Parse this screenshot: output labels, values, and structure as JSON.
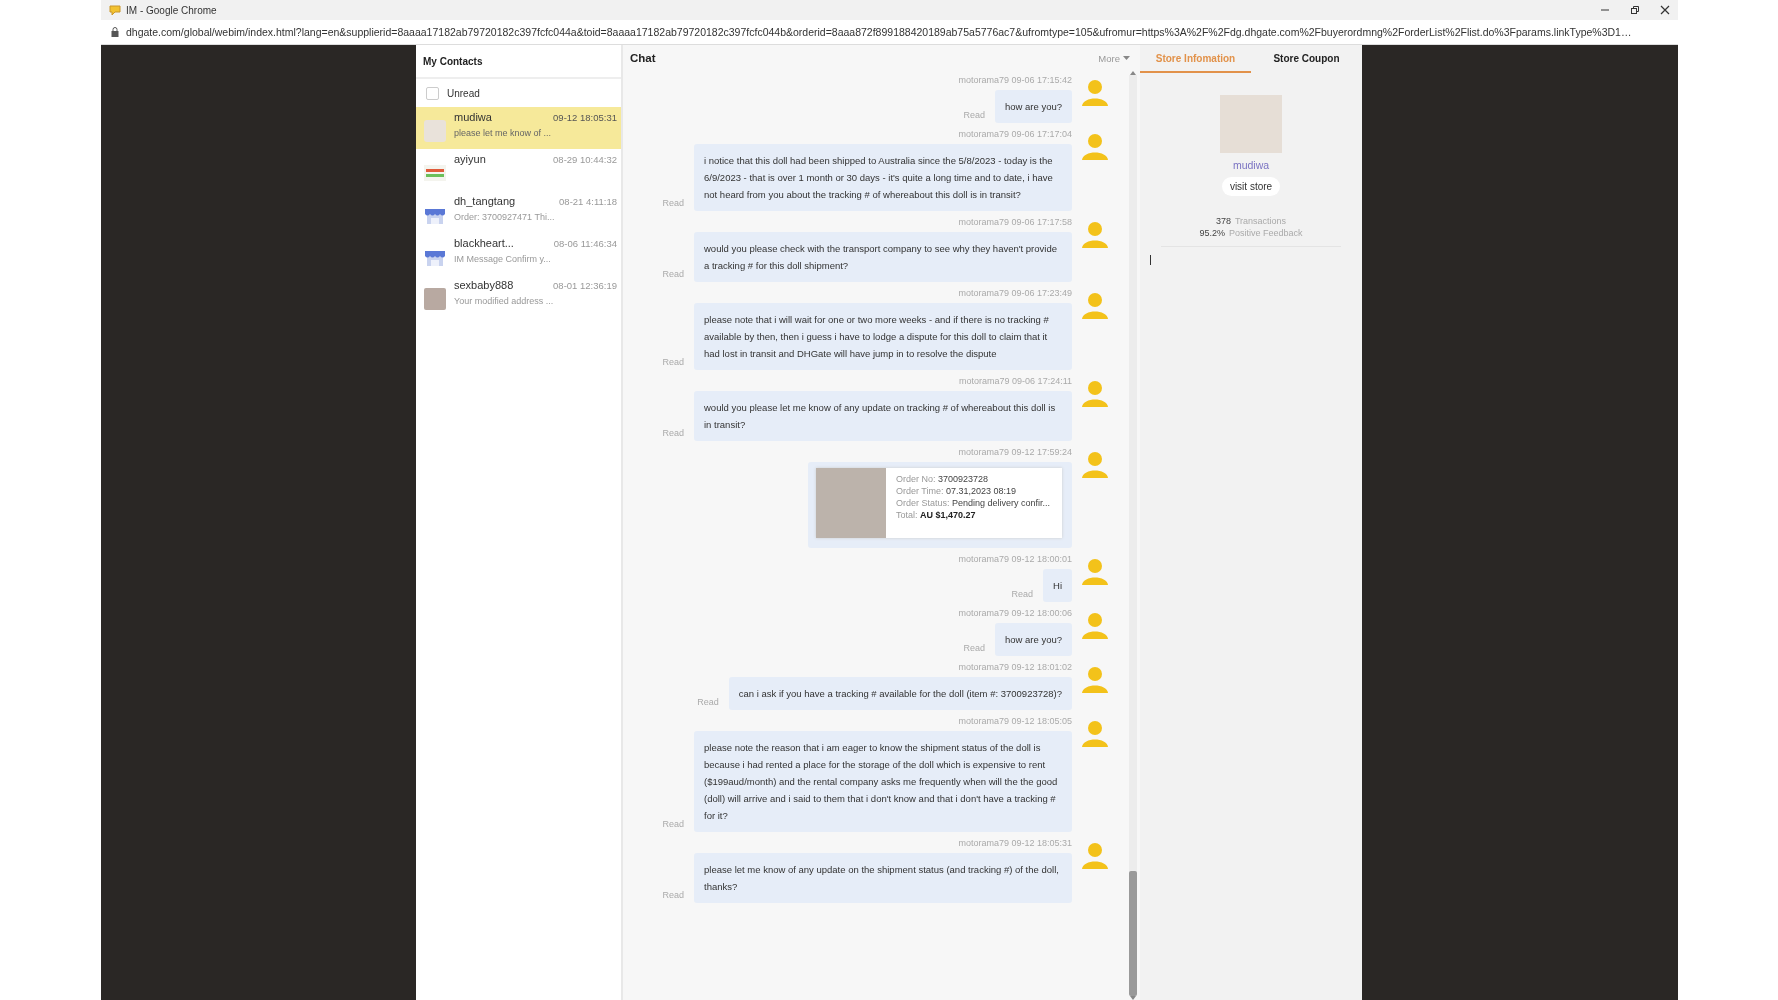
{
  "browser": {
    "title": "IM - Google Chrome",
    "url": "dhgate.com/global/webim/index.html?lang=en&supplierid=8aaaa17182ab79720182c397fcfc044a&toid=8aaaa17182ab79720182c397fcfc044b&orderid=8aaa872f899188420189ab75a5776ac7&ufromtype=105&ufromur=https%3A%2F%2Fdg.dhgate.com%2Fbuyerordmng%2ForderList%2Flist.do%3Fparams.linkType%3D1…"
  },
  "contacts": {
    "title": "My Contacts",
    "unread_filter": {
      "label": "Unread",
      "checked": false
    },
    "items": [
      {
        "name": "mudiwa",
        "time": "09-12 18:05:31",
        "preview": "please let me know of ...",
        "kind": "illustration",
        "selected": true
      },
      {
        "name": "ayiyun",
        "time": "08-29 10:44:32",
        "kind": "logo",
        "selected": false
      },
      {
        "name": "dh_tangtang",
        "time": "08-21 4:11:18",
        "preview": "Order: 3700927471 Thi...",
        "kind": "store",
        "selected": false
      },
      {
        "name": "blackheart...",
        "time": "08-06 11:46:34",
        "preview": "IM Message Confirm y...",
        "kind": "store",
        "selected": false
      },
      {
        "name": "sexbaby888",
        "time": "08-01 12:36:19",
        "preview": "Your modified address ...",
        "kind": "photo",
        "selected": false
      }
    ]
  },
  "chat": {
    "title": "Chat",
    "more": "More",
    "messages": [
      {
        "kind": "text",
        "meta": "motorama79 09-06 17:15:42",
        "status": "Read",
        "text": "how are you?"
      },
      {
        "kind": "text",
        "meta": "motorama79 09-06 17:17:04",
        "status": "Read",
        "text": "i notice that this doll had been shipped to Australia since the 5/8/2023 - today is the 6/9/2023 - that is over 1 month or 30 days - it's quite a long time and to date, i have not heard from you about the tracking # of whereabout this doll is in transit?"
      },
      {
        "kind": "text",
        "meta": "motorama79 09-06 17:17:58",
        "status": "Read",
        "text": "would you please check with the transport company to see why they haven't provide a tracking # for this doll shipment?"
      },
      {
        "kind": "text",
        "meta": "motorama79 09-06 17:23:49",
        "status": "Read",
        "text": "please note that i will wait for one or two more weeks - and if there is no tracking # available by then, then i guess i have to lodge a dispute for this doll to claim that it had lost in transit and DHGate will have jump in to resolve the dispute"
      },
      {
        "kind": "text",
        "meta": "motorama79 09-06 17:24:11",
        "status": "Read",
        "text": "would you please let me know of any update on tracking # of whereabout this doll is in transit?"
      },
      {
        "kind": "order",
        "meta": "motorama79 09-12 17:59:24",
        "order": {
          "lines": [
            {
              "label": "Order No:",
              "value": "3700923728"
            },
            {
              "label": "Order Time:",
              "value": "07.31,2023 08:19"
            },
            {
              "label": "Order Status:",
              "value": "Pending delivery confir..."
            }
          ],
          "total": {
            "label": "Total:",
            "value": "AU $1,470.27"
          }
        }
      },
      {
        "kind": "text",
        "meta": "motorama79 09-12 18:00:01",
        "status": "Read",
        "text": "Hi"
      },
      {
        "kind": "text",
        "meta": "motorama79 09-12 18:00:06",
        "status": "Read",
        "text": "how are you?"
      },
      {
        "kind": "text",
        "meta": "motorama79 09-12 18:01:02",
        "status": "Read",
        "text": "can i ask if you have a tracking # available for the doll (item #: 3700923728)?"
      },
      {
        "kind": "text",
        "meta": "motorama79 09-12 18:05:05",
        "status": "Read",
        "text": "please note the reason that i am eager to know the shipment status of the doll is because i had rented a place for the storage of the doll which is expensive to rent ($199aud/month) and the rental company asks me frequently when will the the good (doll) will arrive and i said to them that i don't know and that i don't have a tracking # for it?"
      },
      {
        "kind": "text",
        "meta": "motorama79 09-12 18:05:31",
        "status": "Read",
        "text": "please let me know of any update on the shipment status (and tracking #) of the doll, thanks?"
      }
    ]
  },
  "store": {
    "tabs": [
      {
        "label": "Store Infomation",
        "selected": true
      },
      {
        "label": "Store Coupon",
        "selected": false
      }
    ],
    "name": "mudiwa",
    "visit": "visit store",
    "stats": [
      {
        "value": "378",
        "label": "Transactions"
      },
      {
        "value": "95.2%",
        "label": "Positive Feedback"
      }
    ]
  }
}
